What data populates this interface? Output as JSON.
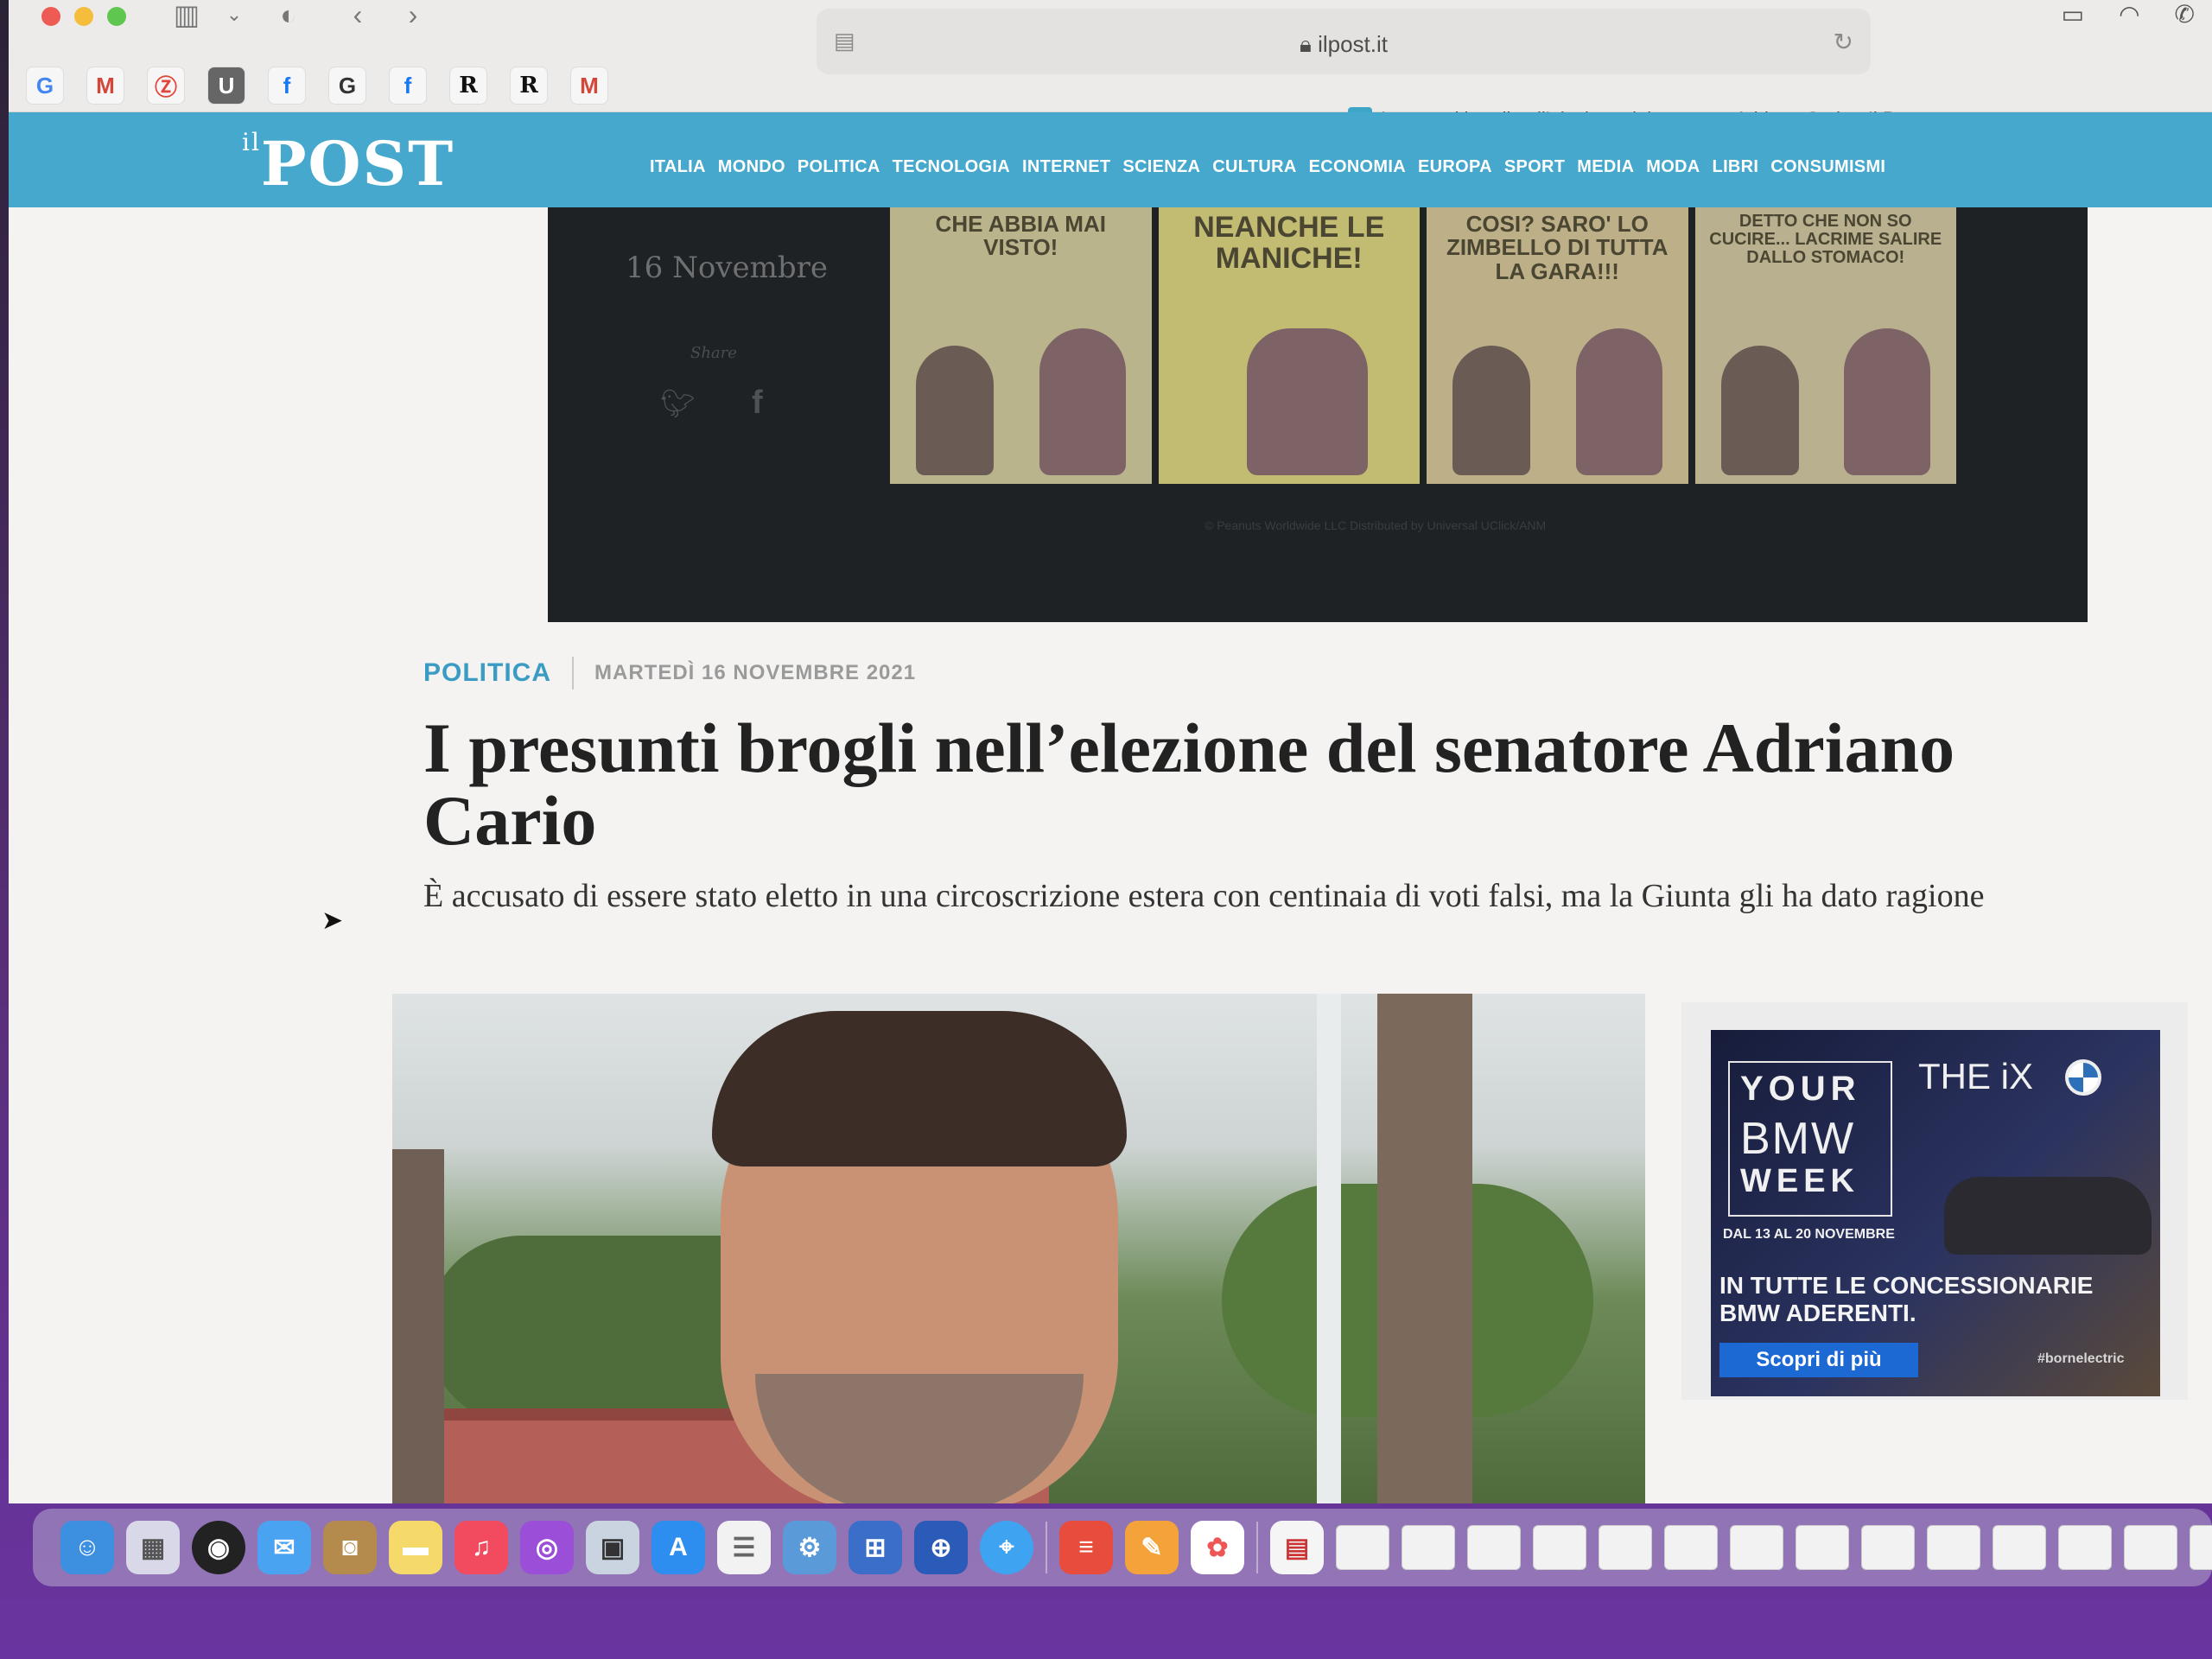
{
  "browser": {
    "url": "ilpost.it",
    "tab_title": "I presunti brogli nell’elezione del senatore Adriano Cario - Il Post",
    "tab_favicon": "P",
    "bookmarks": [
      "G",
      "M",
      "Ⓩ",
      "U",
      "f",
      "G",
      "f",
      "R",
      "R",
      "M"
    ]
  },
  "site": {
    "logo": "POST",
    "logo_prefix": "il",
    "nav": [
      "ITALIA",
      "MONDO",
      "POLITICA",
      "TECNOLOGIA",
      "INTERNET",
      "SCIENZA",
      "CULTURA",
      "ECONOMIA",
      "EUROPA",
      "SPORT",
      "MEDIA",
      "MODA",
      "LIBRI",
      "CONSUMISMI"
    ]
  },
  "peanuts": {
    "date": "16 Novembre",
    "share_label": "Share",
    "panels": [
      "CHE ABBIA MAI VISTO!",
      "NEANCHE LE MANICHE!",
      "COSI? SARO' LO ZIMBELLO DI TUTTA LA GARA!!!",
      "DETTO CHE NON SO CUCIRE... LACRIME SALIRE DALLO STOMACO!"
    ],
    "copyright": "© Peanuts Worldwide LLC Distributed by Universal UClick/ANM"
  },
  "article": {
    "category": "POLITICA",
    "date": "MARTEDÌ 16 NOVEMBRE 2021",
    "headline": "I presunti brogli nell’elezione del senatore Adriano Cario",
    "summary": "È accusato di essere stato eletto in una circoscrizione estera con centinaia di voti falsi, ma la Giunta gli ha dato ragione"
  },
  "ad": {
    "your": "YOUR",
    "bmw": "BMW",
    "week": "WEEK",
    "model": "THE iX",
    "dates": "DAL 13 AL 20 NOVEMBRE",
    "cta": "IN TUTTE LE CONCESSIONARIE BMW ADERENTI.",
    "button": "Scopri di più",
    "hashtag": "#bornelectric",
    "button_color": "#1c69d4"
  },
  "colors": {
    "header_bg": "#46a8cc",
    "category": "#3a9cc4"
  }
}
